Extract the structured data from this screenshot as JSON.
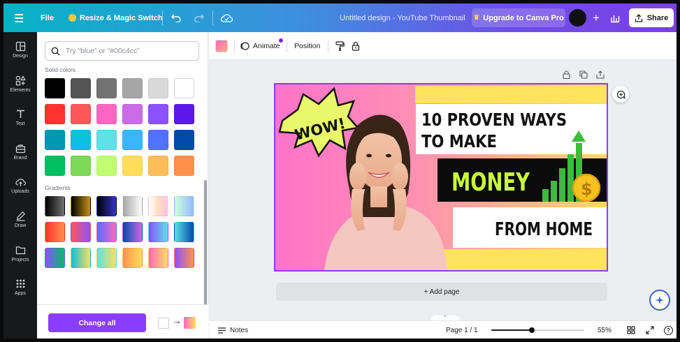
{
  "topbar": {
    "file_label": "File",
    "resize_label": "Resize & Magic Switch",
    "design_title": "Untitled design - YouTube Thumbnail",
    "upgrade_label": "Upgrade to Canva Pro",
    "share_label": "Share"
  },
  "leftnav": {
    "items": [
      {
        "label": "Design",
        "icon": "design-icon"
      },
      {
        "label": "Elements",
        "icon": "elements-icon"
      },
      {
        "label": "Text",
        "icon": "text-icon"
      },
      {
        "label": "Brand",
        "icon": "brand-icon"
      },
      {
        "label": "Uploads",
        "icon": "uploads-icon"
      },
      {
        "label": "Draw",
        "icon": "draw-icon"
      },
      {
        "label": "Projects",
        "icon": "projects-icon"
      },
      {
        "label": "Apps",
        "icon": "apps-icon"
      }
    ]
  },
  "panel": {
    "search_placeholder": "Try “blue” or “#00c4cc”",
    "solid_label": "Solid colors",
    "gradients_label": "Gradients",
    "solid_colors": [
      "#000000",
      "#545454",
      "#737373",
      "#a6a6a6",
      "#d9d9d9",
      "#ffffff",
      "#ff3131",
      "#ff5757",
      "#ff66c4",
      "#cb6ce6",
      "#8c52ff",
      "#5e17eb",
      "#0097b2",
      "#0cc0df",
      "#5ce1e6",
      "#38b6ff",
      "#5271ff",
      "#004aad",
      "#00bf63",
      "#7ed957",
      "#c1ff72",
      "#ffde59",
      "#ffbd59",
      "#ff914d"
    ],
    "gradients": [
      [
        "#000000",
        "#737373"
      ],
      [
        "#000000",
        "#c89116"
      ],
      [
        "#000000",
        "#3533cd"
      ],
      [
        "#a6a6a6",
        "#ffffff"
      ],
      [
        "#ffffff",
        "#ffdbbf",
        "#ffc2e6"
      ],
      [
        "#cdffd8",
        "#94b9ff"
      ],
      [
        "#ff3131",
        "#ff914d"
      ],
      [
        "#ff5757",
        "#8c52ff"
      ],
      [
        "#5170ff",
        "#ff66c4"
      ],
      [
        "#004aad",
        "#cb6ce6"
      ],
      [
        "#8c52ff",
        "#5ce1e6"
      ],
      [
        "#5de0e6",
        "#004aad"
      ],
      [
        "#8c52ff",
        "#00bf63"
      ],
      [
        "#0cc0df",
        "#ffde59"
      ],
      [
        "#5ce1e6",
        "#ffde59"
      ],
      [
        "#ff914d",
        "#ffde59"
      ],
      [
        "#ff66c4",
        "#ffde59"
      ],
      [
        "#8c52ff",
        "#ff914d"
      ]
    ],
    "change_all_label": "Change all"
  },
  "toolbar": {
    "animate_label": "Animate",
    "position_label": "Position"
  },
  "design": {
    "bubble_text": "WOW!",
    "headline_line1": "10 PROVEN WAYS",
    "headline_line2": "TO MAKE",
    "money_text": "MONEY",
    "dollar_text": "$",
    "from_home_text": "FROM HOME"
  },
  "canvas": {
    "add_page_label": "+ Add page"
  },
  "bottombar": {
    "notes_label": "Notes",
    "page_label": "Page 1 / 1",
    "zoom_percent": 55,
    "zoom_label": "55%",
    "help_label": "?"
  },
  "colors": {
    "accent": "#8b3dff",
    "topbar_start": "#06b3c4",
    "topbar_end": "#7b3fe4"
  }
}
